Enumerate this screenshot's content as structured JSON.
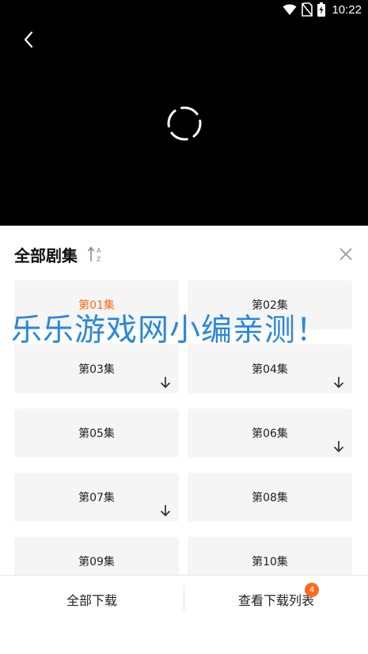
{
  "status_bar": {
    "time": "10:22",
    "icons": [
      "wifi-icon",
      "no-sim-icon",
      "battery-charging-icon"
    ]
  },
  "player": {
    "back_icon": "chevron-left-icon",
    "loading_icon": "loading-spinner-icon"
  },
  "sheet": {
    "title": "全部剧集",
    "sort_icon": "sort-az-icon",
    "close_icon": "close-icon",
    "accent_color": "#ff6a1a",
    "episodes": [
      {
        "label": "第01集",
        "active": true,
        "downloadable": false
      },
      {
        "label": "第02集",
        "active": false,
        "downloadable": false
      },
      {
        "label": "第03集",
        "active": false,
        "downloadable": true
      },
      {
        "label": "第04集",
        "active": false,
        "downloadable": true
      },
      {
        "label": "第05集",
        "active": false,
        "downloadable": false
      },
      {
        "label": "第06集",
        "active": false,
        "downloadable": true
      },
      {
        "label": "第07集",
        "active": false,
        "downloadable": true
      },
      {
        "label": "第08集",
        "active": false,
        "downloadable": false
      },
      {
        "label": "第09集",
        "active": false,
        "downloadable": false
      },
      {
        "label": "第10集",
        "active": false,
        "downloadable": false
      }
    ]
  },
  "watermark": {
    "text": "乐乐游戏网小编亲测！",
    "color": "#2a87d8"
  },
  "bottom_bar": {
    "download_all_label": "全部下载",
    "view_list_label": "查看下载列表",
    "badge_count": "4"
  }
}
